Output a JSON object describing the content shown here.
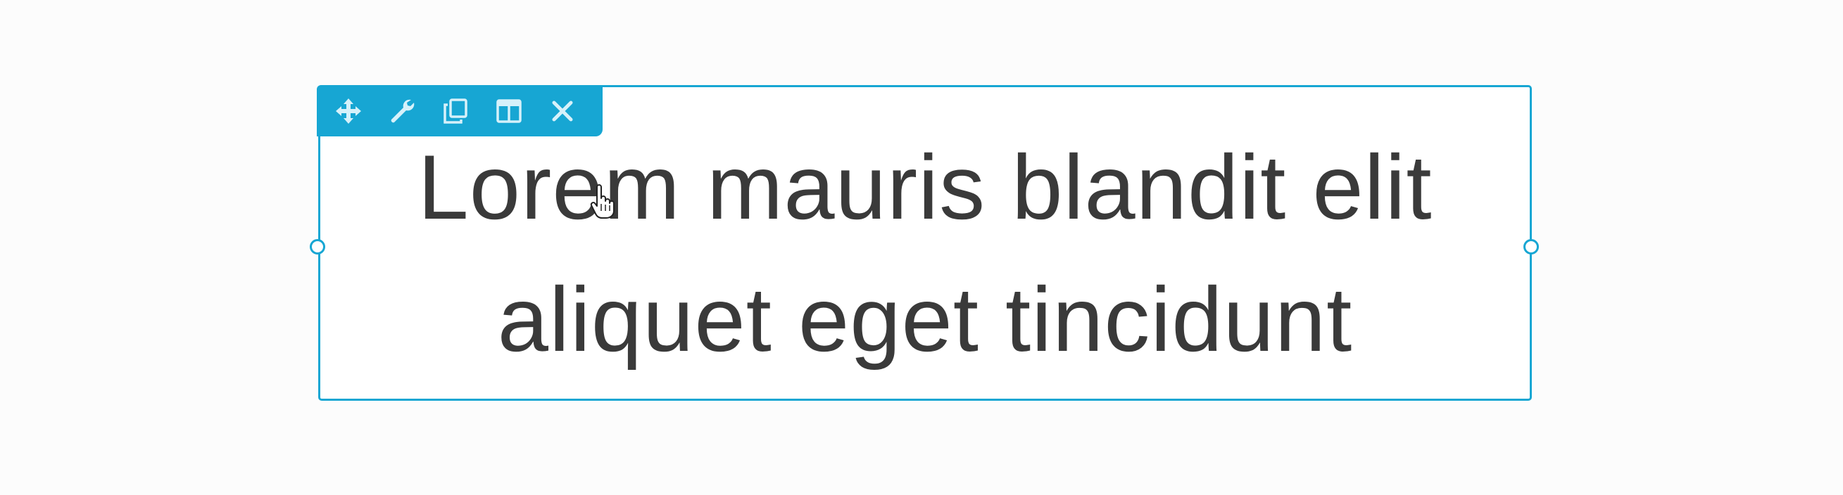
{
  "toolbar": {
    "icons": [
      "move-icon",
      "wrench-icon",
      "duplicate-icon",
      "columns-icon",
      "close-icon"
    ],
    "color": "#17a6d3"
  },
  "module": {
    "text_line_1": "Lorem mauris blandit elit",
    "text_line_2": "aliquet eget tincidunt",
    "border_color": "#17a6d3",
    "text_color": "#3a3a3a"
  }
}
